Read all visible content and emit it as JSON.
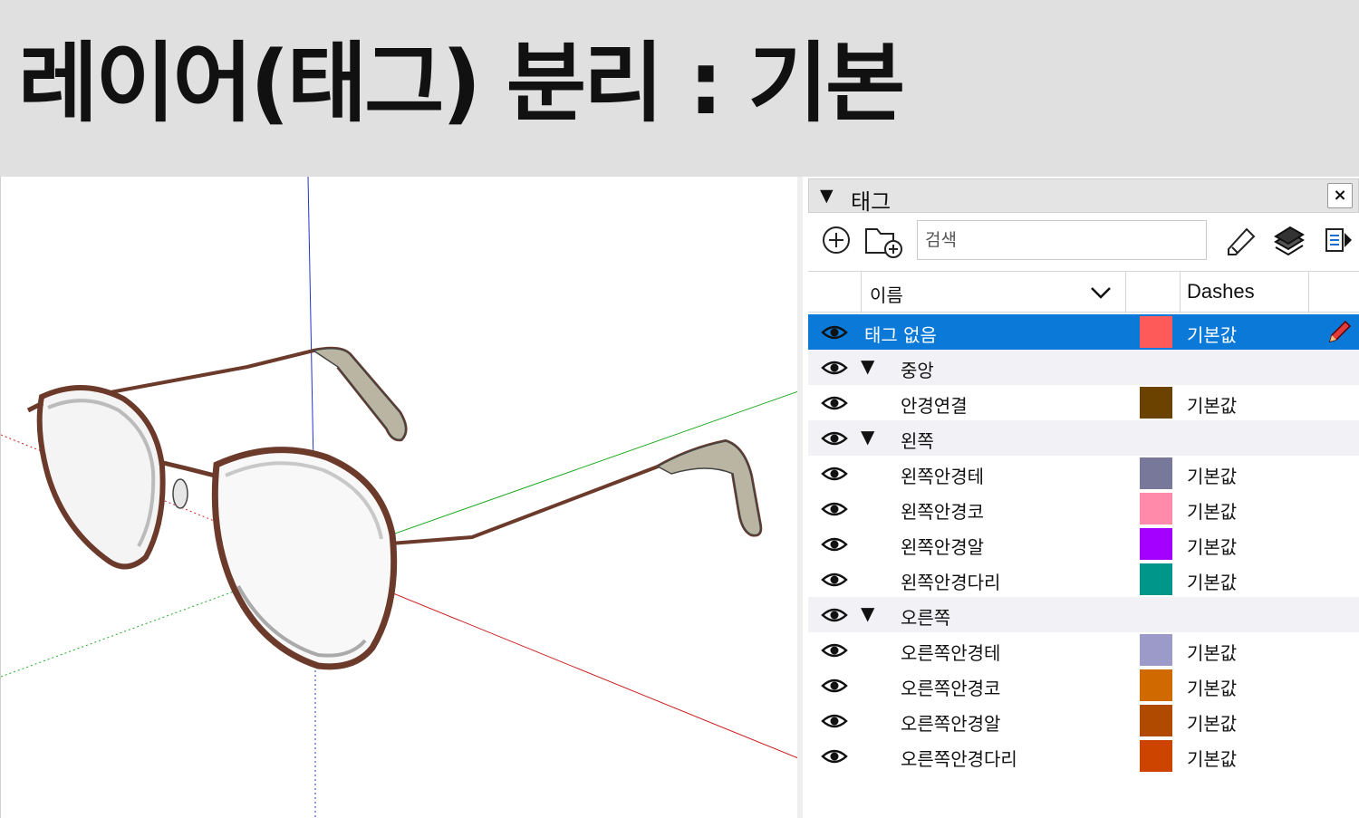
{
  "banner": {
    "title": "레이어(태그) 분리 : 기본"
  },
  "panel": {
    "title": "태그",
    "close_label": "×",
    "collapse_icon": "triangle-down-icon",
    "toolbar": {
      "search_placeholder": "검색",
      "icons": [
        "add-tag-icon",
        "add-folder-icon",
        "paint-bucket-icon",
        "color-by-tag-icon",
        "details-icon"
      ]
    },
    "columns": {
      "name": "이름",
      "dashes": "Dashes"
    },
    "rows": [
      {
        "name": "태그 없음",
        "dashes": "기본값",
        "color": "#ff5a5a",
        "level": 0,
        "selected": true,
        "folder": false
      },
      {
        "name": "중앙",
        "dashes": "",
        "color": "",
        "level": 0,
        "selected": false,
        "folder": true
      },
      {
        "name": "안경연결",
        "dashes": "기본값",
        "color": "#6b4200",
        "level": 1,
        "selected": false,
        "folder": false
      },
      {
        "name": "왼쪽",
        "dashes": "",
        "color": "",
        "level": 0,
        "selected": false,
        "folder": true
      },
      {
        "name": "왼쪽안경테",
        "dashes": "기본값",
        "color": "#77789a",
        "level": 1,
        "selected": false,
        "folder": false
      },
      {
        "name": "왼쪽안경코",
        "dashes": "기본값",
        "color": "#ff8aaa",
        "level": 1,
        "selected": false,
        "folder": false
      },
      {
        "name": "왼쪽안경알",
        "dashes": "기본값",
        "color": "#a300ff",
        "level": 1,
        "selected": false,
        "folder": false
      },
      {
        "name": "왼쪽안경다리",
        "dashes": "기본값",
        "color": "#00968a",
        "level": 1,
        "selected": false,
        "folder": false
      },
      {
        "name": "오른쪽",
        "dashes": "",
        "color": "",
        "level": 0,
        "selected": false,
        "folder": true
      },
      {
        "name": "오른쪽안경테",
        "dashes": "기본값",
        "color": "#9c9ac8",
        "level": 1,
        "selected": false,
        "folder": false
      },
      {
        "name": "오른쪽안경코",
        "dashes": "기본값",
        "color": "#d06a00",
        "level": 1,
        "selected": false,
        "folder": false
      },
      {
        "name": "오른쪽안경알",
        "dashes": "기본값",
        "color": "#b04a00",
        "level": 1,
        "selected": false,
        "folder": false
      },
      {
        "name": "오른쪽안경다리",
        "dashes": "기본값",
        "color": "#cc4400",
        "level": 1,
        "selected": false,
        "folder": false
      }
    ]
  },
  "colors": {
    "selection": "#0a79d8",
    "frame": "#6b3a2a",
    "temple_tip": "#b9b5a2",
    "axis_red": "#cc2222",
    "axis_green": "#22aa22",
    "axis_blue": "#2222cc"
  }
}
